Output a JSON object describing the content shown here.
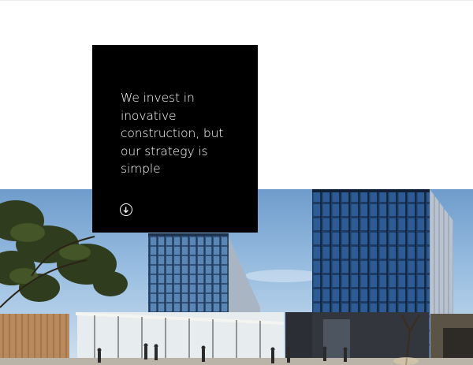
{
  "hero": {
    "heading": "We invest in inovative construction, but our strategy is simple",
    "scroll_button_icon": "arrow-down-circle-icon"
  },
  "colors": {
    "card_background": "#000000",
    "card_text": "#ffffff",
    "page_background": "#ffffff"
  }
}
